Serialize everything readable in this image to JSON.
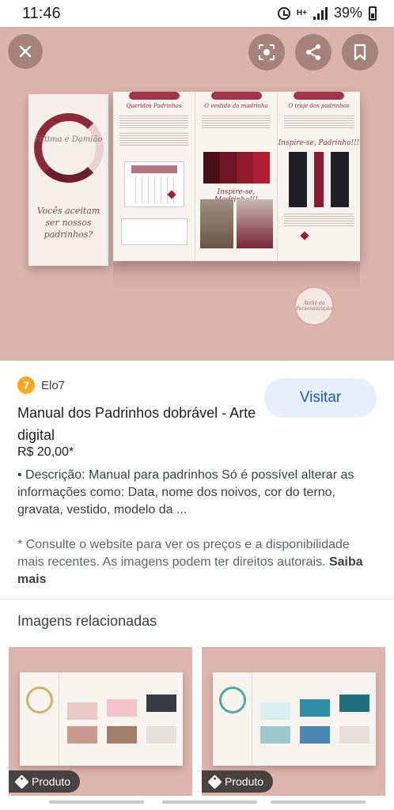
{
  "status_bar": {
    "time": "11:46",
    "battery": "39%",
    "network": "H+"
  },
  "hero": {
    "cover_names": "Fátima e Damião",
    "cover_question": "Vocês aceitam ser nossos padrinhos?",
    "panels": [
      {
        "title": "Queridos Padrinhos"
      },
      {
        "title": "O vestido da madrinha",
        "caption": "Inspire-se, Madrinha!!!"
      },
      {
        "title": "O traje dos padrinhos",
        "caption": "Inspire-se, Padrinho!!!"
      }
    ],
    "stamp_text": "Ateliê da Personalização",
    "icons": {
      "close": "close-icon",
      "lens": "lens-icon",
      "share": "share-icon",
      "save": "bookmark-icon"
    }
  },
  "source": {
    "logo_letter": "7",
    "name": "Elo7"
  },
  "visit_label": "Visitar",
  "product": {
    "title": "Manual dos Padrinhos dobrável - Arte digital",
    "price": "R$ 20,00*",
    "description": "• Descrição: Manual para padrinhos Só é possível alterar as informações como: Data, nome dos noivos, cor do terno, gravata, vestido, modelo da ...",
    "note": "* Consulte o website para ver os preços e a disponibilidade mais recentes. As imagens podem ter direitos autorais.",
    "learn_more": "Saiba mais"
  },
  "related": {
    "title": "Imagens relacionadas",
    "items": [
      {
        "badge": "Produto",
        "accent": "#d4b06a"
      },
      {
        "badge": "Produto",
        "accent": "#5aa5a8"
      }
    ]
  }
}
